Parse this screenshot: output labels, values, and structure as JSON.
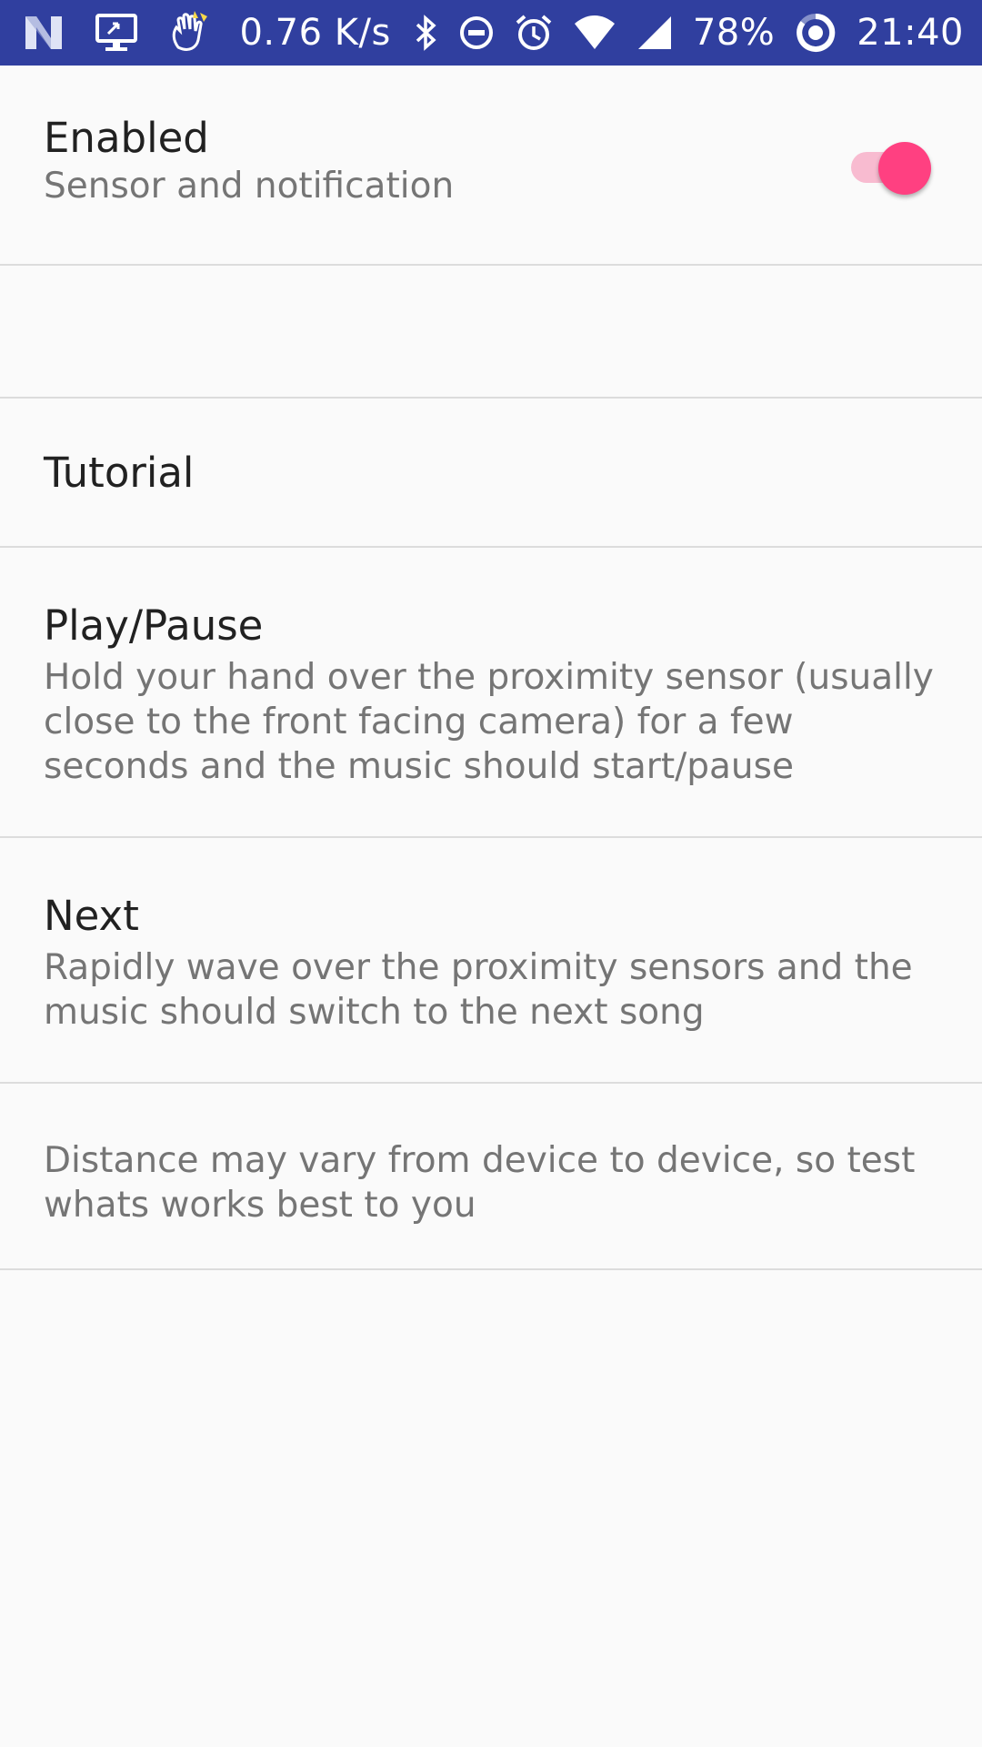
{
  "status_bar": {
    "network_speed": "0.76 K/s",
    "battery": "78%",
    "time": "21:40",
    "icons": [
      "notification-n-icon",
      "screen-cast-icon",
      "wave-hand-icon",
      "bluetooth-icon",
      "do-not-disturb-icon",
      "alarm-icon",
      "wifi-icon",
      "signal-icon",
      "battery-icon"
    ]
  },
  "preferences": {
    "enabled": {
      "title": "Enabled",
      "summary": "Sensor and notification",
      "checked": true
    },
    "tutorial": {
      "title": "Tutorial"
    },
    "play_pause": {
      "title": "Play/Pause",
      "summary": "Hold your hand over the proximity sensor (usually close to the front facing camera) for a few seconds and the music should start/pause"
    },
    "next": {
      "title": "Next",
      "summary": "Rapidly wave over the proximity sensors and the music should switch to the next song"
    },
    "note": {
      "summary": "Distance may vary from device to device, so test whats works best to you"
    }
  },
  "colors": {
    "status_bar": "#303f9f",
    "accent": "#ff4081",
    "track": "#f8bbd0",
    "background": "#fafafa"
  }
}
